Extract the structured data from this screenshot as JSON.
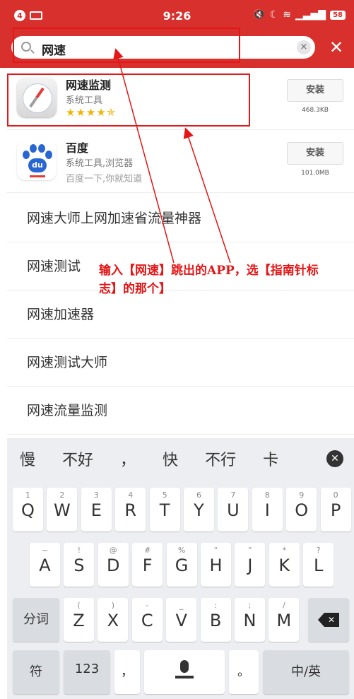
{
  "status_bar": {
    "notification_count": "4",
    "time": "9:26",
    "battery": "58"
  },
  "search": {
    "query": "网速",
    "clear_label": "×",
    "close_label": "✕"
  },
  "apps": [
    {
      "name": "网速监测",
      "category": "系统工具",
      "stars": "★★★★✯",
      "install_label": "安装",
      "size": "468.3KB"
    },
    {
      "name": "百度",
      "category": "系统工具,浏览器",
      "slogan": "百度一下,你就知道",
      "install_label": "安装",
      "size": "101.0MB",
      "icon_text": "du"
    }
  ],
  "suggestions": [
    "网速大师上网加速省流量神器",
    "网速测试",
    "网速加速器",
    "网速测试大师",
    "网速流量监测"
  ],
  "annotation": {
    "text": "输入【网速】跳出的APP，选【指南针标志】的那个】"
  },
  "keyboard": {
    "candidates": [
      "慢",
      "不好",
      "，",
      "快",
      "不行",
      "卡"
    ],
    "row1": [
      {
        "sub": "1",
        "main": "Q"
      },
      {
        "sub": "2",
        "main": "W"
      },
      {
        "sub": "3",
        "main": "E"
      },
      {
        "sub": "4",
        "main": "R"
      },
      {
        "sub": "5",
        "main": "T"
      },
      {
        "sub": "6",
        "main": "Y"
      },
      {
        "sub": "7",
        "main": "U"
      },
      {
        "sub": "8",
        "main": "I"
      },
      {
        "sub": "9",
        "main": "O"
      },
      {
        "sub": "0",
        "main": "P"
      }
    ],
    "row2": [
      {
        "sub": "~",
        "main": "A"
      },
      {
        "sub": "!",
        "main": "S"
      },
      {
        "sub": "@",
        "main": "D"
      },
      {
        "sub": "#",
        "main": "F"
      },
      {
        "sub": "%",
        "main": "G"
      },
      {
        "sub": "“",
        "main": "H"
      },
      {
        "sub": "”",
        "main": "J"
      },
      {
        "sub": "*",
        "main": "K"
      },
      {
        "sub": "?",
        "main": "L"
      }
    ],
    "row3": [
      {
        "sub": "(",
        "main": "Z"
      },
      {
        "sub": ")",
        "main": "X"
      },
      {
        "sub": "-",
        "main": "C"
      },
      {
        "sub": "_",
        "main": "V"
      },
      {
        "sub": ":",
        "main": "B"
      },
      {
        "sub": ";",
        "main": "N"
      },
      {
        "sub": "/",
        "main": "M"
      }
    ],
    "segment_label": "分词",
    "symbol_label": "符",
    "numeric_label": "123",
    "comma_label": "，",
    "period_label": "。",
    "chinese_label": "中/英"
  },
  "colors": {
    "header_red": "#d8302c",
    "annotation_red": "#e41616",
    "star_yellow": "#f5b400"
  }
}
